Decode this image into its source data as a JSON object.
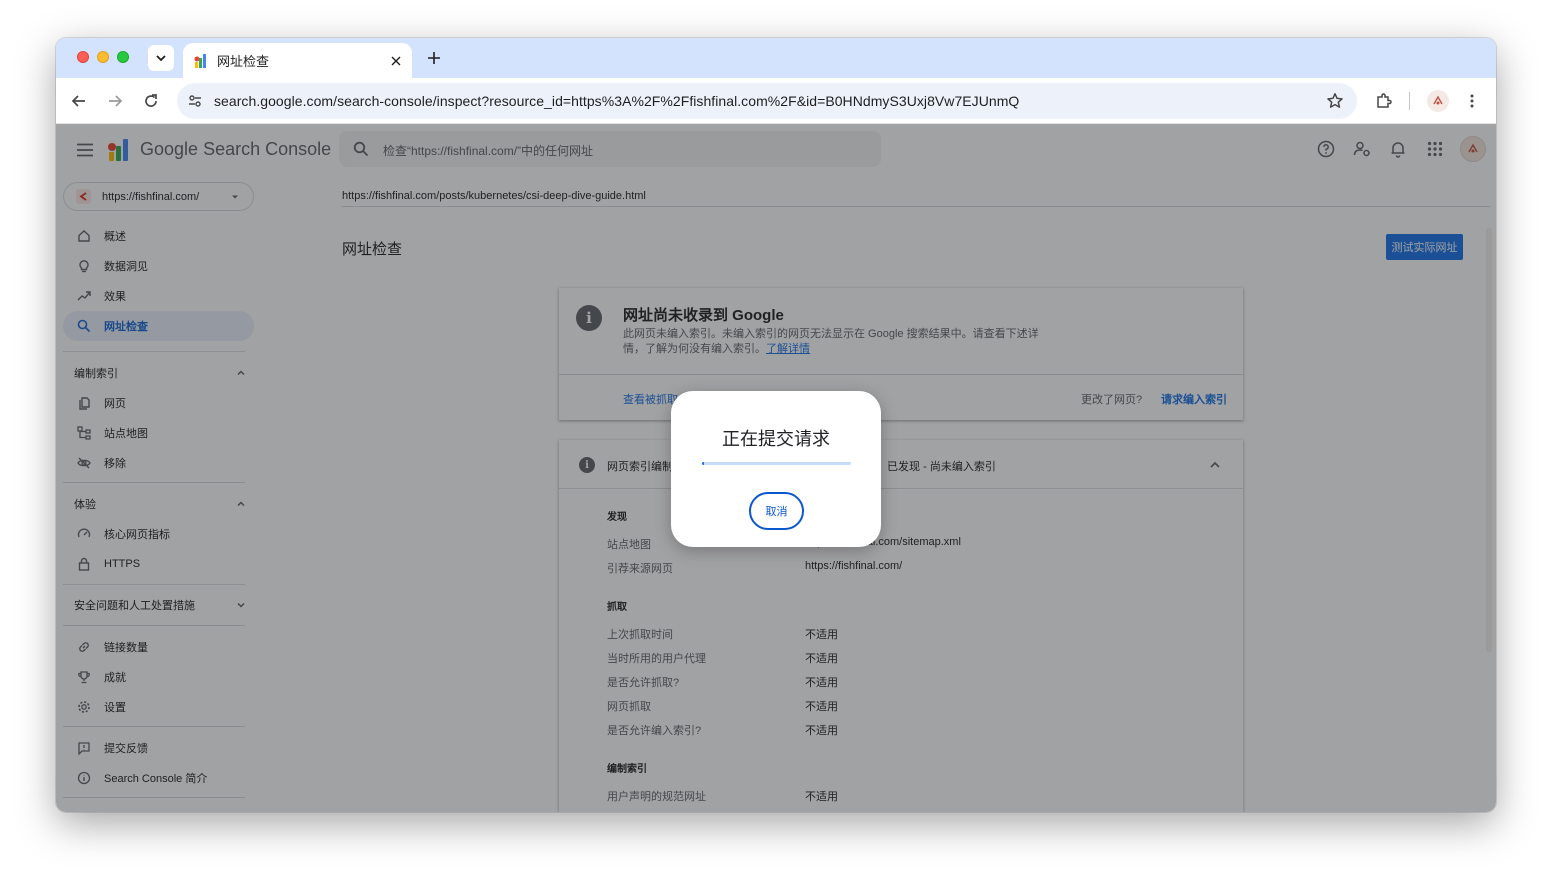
{
  "browser": {
    "tab_title": "网址检查",
    "url": "search.google.com/search-console/inspect?resource_id=https%3A%2F%2Ffishfinal.com%2F&id=B0HNdmyS3Uxj8Vw7EJUnmQ"
  },
  "header": {
    "logo_google": "Google",
    "logo_product": "Search Console",
    "search_placeholder": "检查“https://fishfinal.com/”中的任何网址"
  },
  "sidebar": {
    "property": "https://fishfinal.com/",
    "items_top": [
      {
        "label": "概述"
      },
      {
        "label": "数据洞见"
      },
      {
        "label": "效果"
      },
      {
        "label": "网址检查"
      }
    ],
    "section_index": "编制索引",
    "items_index": [
      {
        "label": "网页"
      },
      {
        "label": "站点地图"
      },
      {
        "label": "移除"
      }
    ],
    "section_experience": "体验",
    "items_experience": [
      {
        "label": "核心网页指标"
      },
      {
        "label": "HTTPS"
      }
    ],
    "section_security": "安全问题和人工处置措施",
    "items_more": [
      {
        "label": "链接数量"
      },
      {
        "label": "成就"
      },
      {
        "label": "设置"
      }
    ],
    "items_footer": [
      {
        "label": "提交反馈"
      },
      {
        "label": "Search Console 简介"
      }
    ]
  },
  "main": {
    "inspected_url": "https://fishfinal.com/posts/kubernetes/csi-deep-dive-guide.html",
    "title": "网址检查",
    "test_live_button": "测试实际网址",
    "status": {
      "title": "网址尚未收录到 Google",
      "desc": "此网页未编入索引。未编入索引的网页无法显示在 Google 搜索结果中。请查看下述详情，了解为何没有编入索引。",
      "learn_more": "了解详情",
      "view_crawled": "查看被抓取",
      "changed_q": "更改了网页?",
      "request_index": "请求编入索引"
    },
    "details": {
      "header_left": "网页索引编制",
      "header_right": "]：已发现 - 尚未编入索引",
      "section_discovery": "发现",
      "discovery": [
        {
          "label": "站点地图",
          "value": "https://fishfinal.com/sitemap.xml"
        },
        {
          "label": "引荐来源网页",
          "value": "https://fishfinal.com/"
        }
      ],
      "section_crawl": "抓取",
      "crawl": [
        {
          "label": "上次抓取时间",
          "value": "不适用"
        },
        {
          "label": "当时所用的用户代理",
          "value": "不适用"
        },
        {
          "label": "是否允许抓取?",
          "value": "不适用"
        },
        {
          "label": "网页抓取",
          "value": "不适用"
        },
        {
          "label": "是否允许编入索引?",
          "value": "不适用"
        }
      ],
      "section_indexing": "编制索引",
      "indexing": [
        {
          "label": "用户声明的规范网址",
          "value": "不适用"
        }
      ]
    }
  },
  "dialog": {
    "title": "正在提交请求",
    "progress": 0.01,
    "cancel_button": "取消"
  }
}
